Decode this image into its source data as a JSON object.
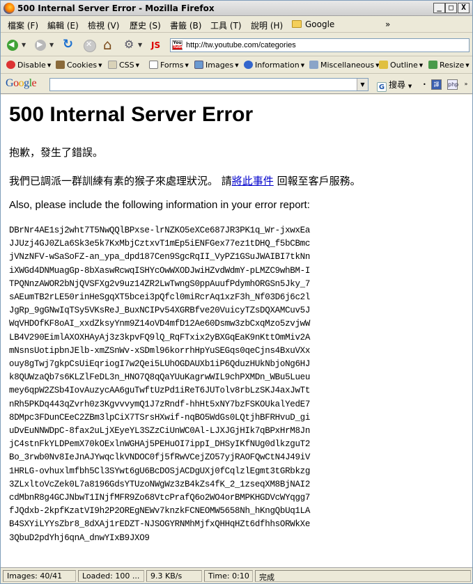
{
  "window": {
    "title": "500 Internal Server Error - Mozilla Firefox",
    "buttons": {
      "min": "_",
      "max": "□",
      "close": "X"
    }
  },
  "menu": {
    "items": [
      "檔案 (F)",
      "編輯 (E)",
      "檢視 (V)",
      "歷史 (S)",
      "書籤 (B)",
      "工具 (T)",
      "說明 (H)"
    ],
    "bookmark": "Google",
    "overflow": "»"
  },
  "nav": {
    "url": "http://tw.youtube.com/categories",
    "js_label": "JS",
    "favicon_top": "You",
    "favicon_bottom": "Tube"
  },
  "devtoolbar": {
    "items": [
      "Disable",
      "Cookies",
      "CSS",
      "Forms",
      "Images",
      "Information",
      "Miscellaneous",
      "Outline",
      "Resize"
    ]
  },
  "google": {
    "logo": "Google",
    "search_value": "",
    "search_button": "搜尋",
    "icon_a": "譯",
    "icon_b": "php"
  },
  "page": {
    "heading": "500 Internal Server Error",
    "sorry": "抱歉，發生了錯誤。",
    "monkeys_before": "我們已調派一群訓練有素的猴子來處理狀況。 請",
    "monkeys_link": "將此事件",
    "monkeys_after": " 回報至客戶服務。",
    "include_info": "Also, please include the following information in your error report:",
    "error_lines": [
      "DBrNr4AE1sj2wht7T5NwQQlBPxse-lrNZKO5eXCe687JR3PK1q_Wr-jxwxEa",
      "JJUzj4GJ0ZLa6Sk3e5k7KxMbjCztxvT1mEp5iENFGex77ez1tDHQ_f5bCBmc",
      "jVNzNFV-wSaSoFZ-an_ypa_dpd187Cen9SgcRqII_VyPZ1GSuJWAIBI7tkNn",
      "iXWGd4DNMuagGp-8bXaswRcwqISHYcOwWXODJwiHZvdWdmY-pLMZC9whBM-I",
      "TPQNnzAWOR2bNjQVSFXg2v9uz14ZR2LwTwngS0ppAuufPdymhORGSn5Jky_7",
      "sAEumTB2rLE50rinHeSgqXT5bcei3pQfcl0miRcrAq1xzF3h_Nf03D6j6c2l",
      "JgRp_9gGNwIqTSy5VKsReJ_BuxNCIPv54XGRBfve20VuicyTZsDQXAMCuv5J",
      "WqVHDOfKF8oAI_xxdZksyYnm9Z14oVD4mfD12Ae60Dsmw3zbCxqMzo5zvjwW",
      "LB4V290EimlAXOXHAyAj3z3kpvFQ9lQ_RqFTxix2yBXGqEaK9nKttOmMiv2A",
      "mNsnsUotipbnJElb-xmZSnWv-xSDml96korrhHpYuSEGqs0qeCjns4BxuVXx",
      "ouy8gTwj7gkpCsUiEqriogI7w2Qei5LUhOGDAUXb1iP6QduzHUkNbjoNg6HJ",
      "k8QUWzaQb7s6KLZlFeDL3n_HNO7Q8qQaYUuKagrwWIL9chPXMDn_WBu5Lueu",
      "mey6qpW2ZSb4IovAuzycAA6guTwftUzPd1iReT6JUTolv8rbLzSKJ4axJwTt",
      "nRh5PKDq443qZvrh0z3KgvvvymQ1J7zRndf-hhHt5xNY7bzFSKOUkalYedE7",
      "8DMpc3FDunCEeC2ZBm3lpCiX7TSrsHXwif-nqBO5WdGs0LQtjhBFRHvuD_gi",
      "uDvEuNNWDpC-8fax2uLjXEyeYL3SZzCiUnWC0Al-LJXJGjHIk7qBPxHrM8Jn",
      "jC4stnFkYLDPemX70kOExlnWGHAj5PEHuOI7ippI_DHSyIKfNUg0dlkzguT2",
      "Bo_3rwb0Nv8IeJnAJYwqclkVNDOC0fj5fRwVCejZO57yjRAOFQwCtN4J49iV",
      "1HRLG-ovhuxlmfbh5Cl3SYwt6gU6BcDOSjACDgUXj0fCqlzlEgmt3tGRbkzg",
      "3ZLxltoVcZek0L7a8196GdsYTUzoNWgWz3zB4kZs4fK_2_1zseqXM8BjNAI2",
      "cdMbnR8g4GCJNbwT1INjfMFR9Zo68VtcPrafQ6o2WO4orBMPKHGDVcWYqgg7",
      "fJQdxb-2kpfKzatVI9h2P2OREgNEWv7knzkFCNEOMW5658Nh_hKngQbUq1LA",
      "B4SXYiLYYsZbr8_8dXAj1rEDZT-NJSOGYRNMhMjfxQHHqHZt6dfhhsORWkXe",
      "3QbuD2pdYhj6qnA_dnwYIxB9JXO9"
    ]
  },
  "status": {
    "images": "Images: 40/41",
    "loaded": "Loaded: 100 ...",
    "speed": "9.3 KB/s",
    "time": "Time: 0:10",
    "done": "完成"
  }
}
